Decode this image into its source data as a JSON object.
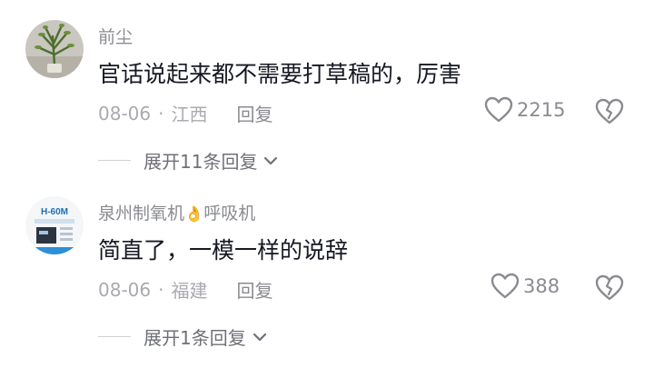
{
  "comments": [
    {
      "username": "前尘",
      "text": "官话说起来都不需要打草稿的，厉害",
      "date": "08-06",
      "location": "江西",
      "reply_label": "回复",
      "likes": "2215",
      "expand_label": "展开11条回复"
    },
    {
      "username_prefix": "泉州制氧机",
      "username_emoji": "👌",
      "username_suffix": "呼吸机",
      "avatar_text": "H-60M",
      "text": "简直了，一模一样的说辞",
      "date": "08-06",
      "location": "福建",
      "reply_label": "回复",
      "likes": "388",
      "expand_label": "展开1条回复"
    }
  ],
  "separator": "·",
  "icons": {
    "like": "heart-outline-icon",
    "dislike": "broken-heart-icon",
    "expand": "chevron-down-icon"
  },
  "colors": {
    "username": "#8a8b91",
    "content": "#161823",
    "meta": "#a9aab0"
  }
}
